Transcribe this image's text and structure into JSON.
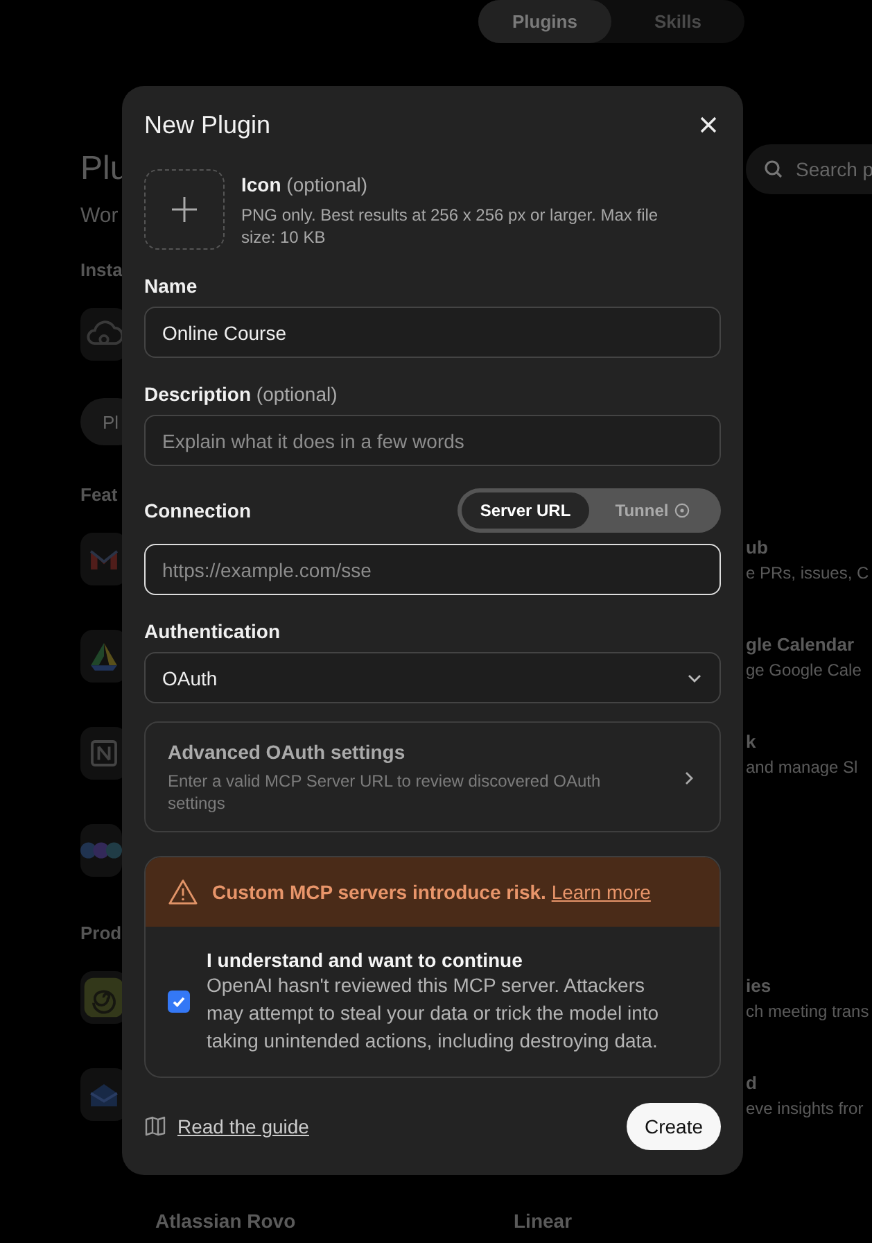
{
  "background": {
    "tabs": [
      {
        "label": "Plugins",
        "selected": true
      },
      {
        "label": "Skills",
        "selected": false
      }
    ],
    "search": {
      "placeholder": "Search p"
    },
    "rows": [
      {
        "kind": "title",
        "text": "Plu"
      },
      {
        "kind": "subtitle",
        "text": "Wor"
      },
      {
        "kind": "section",
        "text": "Insta"
      },
      {
        "kind": "tile"
      },
      {
        "kind": "pill",
        "text": "Pl"
      },
      {
        "kind": "section",
        "text": "Feat"
      },
      {
        "kind": "tile",
        "name": "ub",
        "description": "e PRs, issues, C"
      },
      {
        "kind": "tile",
        "name": "gle Calendar",
        "description": "ge Google Cale"
      },
      {
        "kind": "tile",
        "name": "k",
        "description": "and manage Sl"
      },
      {
        "kind": "tile"
      },
      {
        "kind": "section",
        "text": "Prod"
      },
      {
        "kind": "tile",
        "name": "ies",
        "description": "ch meeting trans"
      },
      {
        "kind": "tile",
        "name": "d",
        "description": "eve insights fror"
      }
    ],
    "bottom": [
      "Atlassian Rovo",
      "Linear"
    ]
  },
  "dialog": {
    "title": "New Plugin",
    "icon_field": {
      "label": "Icon",
      "optional": "(optional)",
      "hint": "PNG only. Best results at 256 x 256 px or larger. Max file size: 10 KB"
    },
    "name": {
      "label": "Name",
      "value": "Online Course"
    },
    "description": {
      "label": "Description",
      "optional": "(optional)",
      "placeholder": "Explain what it does in a few words"
    },
    "connection": {
      "label": "Connection",
      "options": [
        {
          "label": "Server URL",
          "selected": true
        },
        {
          "label": "Tunnel",
          "selected": false
        }
      ],
      "url": {
        "placeholder": "https://example.com/sse",
        "focused": true
      }
    },
    "authentication": {
      "label": "Authentication",
      "value": "OAuth"
    },
    "advanced": {
      "title": "Advanced OAuth settings",
      "text": "Enter a valid MCP Server URL to review discovered OAuth settings"
    },
    "warning": {
      "text": "Custom MCP servers introduce risk.",
      "link": "Learn more"
    },
    "consent": {
      "title": "I understand and want to continue",
      "text": "OpenAI hasn't reviewed this MCP server. Attackers may attempt to steal your data or trick the model into taking unintended actions, including destroying data.",
      "checked": true
    },
    "guide_link": "Read the guide",
    "create": "Create"
  }
}
